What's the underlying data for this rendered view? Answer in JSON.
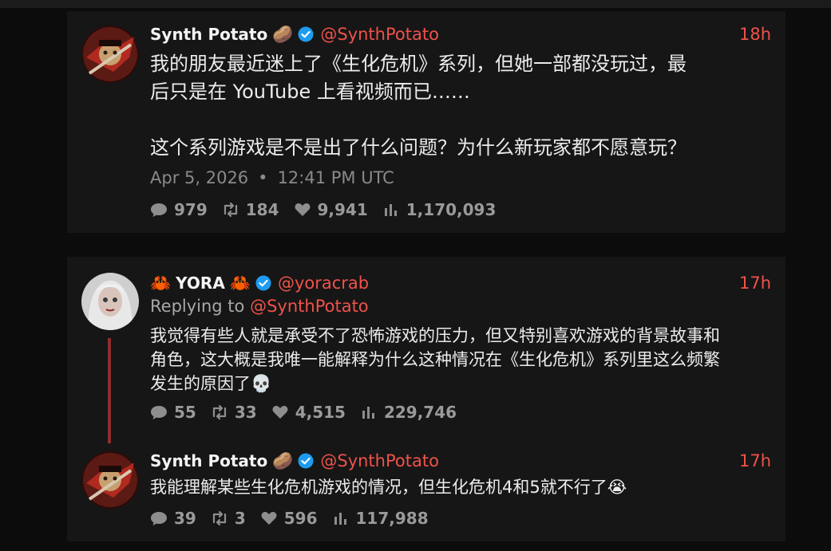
{
  "tweet1": {
    "name": "Synth Potato",
    "name_emoji": "🥔",
    "handle": "@SynthPotato",
    "time": "18h",
    "text": "我的朋友最近迷上了《生化危机》系列，但她一部都没玩过，最\n后只是在 YouTube 上看视频而已……\n\n这个系列游戏是不是出了什么问题？为什么新玩家都不愿意玩？",
    "date": "Apr 5, 2026",
    "date_sep": "•",
    "clock": "12:41 PM UTC",
    "stats": {
      "replies": "979",
      "retweets": "184",
      "likes": "9,941",
      "views": "1,170,093"
    }
  },
  "tweet2": {
    "name_prefix": "🦀",
    "name": "YORA",
    "name_suffix": "🦀",
    "handle": "@yoracrab",
    "time": "17h",
    "replying_label": "Replying to",
    "replying_handle": "@SynthPotato",
    "text": "我觉得有些人就是承受不了恐怖游戏的压力，但又特别喜欢游戏的背景故事和\n角色，这大概是我唯一能解释为什么这种情况在《生化危机》系列里这么频繁\n发生的原因了💀",
    "stats": {
      "replies": "55",
      "retweets": "33",
      "likes": "4,515",
      "views": "229,746"
    }
  },
  "tweet3": {
    "name": "Synth Potato",
    "name_emoji": "🥔",
    "handle": "@SynthPotato",
    "time": "17h",
    "text": "我能理解某些生化危机游戏的情况，但生化危机4和5就不行了😭",
    "stats": {
      "replies": "39",
      "retweets": "3",
      "likes": "596",
      "views": "117,988"
    }
  },
  "colors": {
    "accent": "#f0524a",
    "verified": "#1d9bf0",
    "thread": "#8c2f2c"
  },
  "icons": [
    "speech-bubble-icon",
    "retweet-icon",
    "heart-icon",
    "bar-chart-icon",
    "verified-badge-icon"
  ]
}
